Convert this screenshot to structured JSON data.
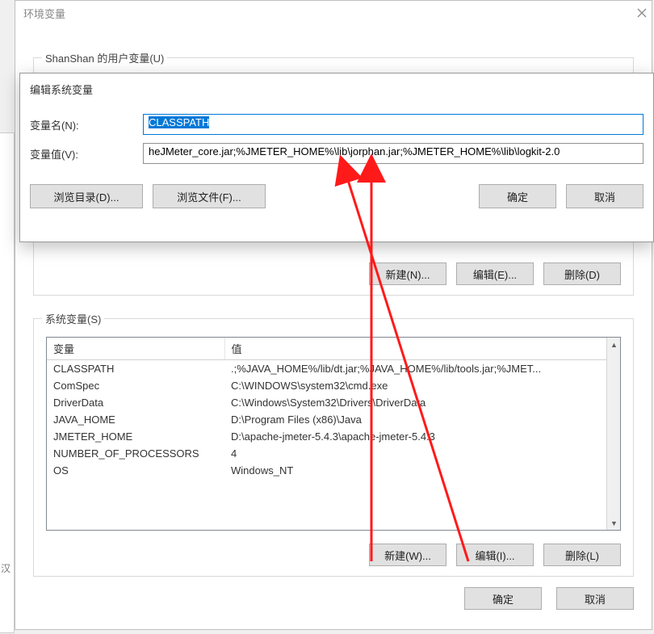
{
  "main_window": {
    "title": "环境变量",
    "user_group_label": "ShanShan 的用户变量(U)",
    "sys_group_label": "系统变量(S)",
    "user_buttons": {
      "new": "新建(N)...",
      "edit": "编辑(E)...",
      "delete": "删除(D)"
    },
    "sys_buttons": {
      "new": "新建(W)...",
      "edit": "编辑(I)...",
      "delete": "删除(L)"
    },
    "lower_buttons": {
      "ok": "确定",
      "cancel": "取消"
    },
    "sys_table": {
      "headers": {
        "var": "变量",
        "val": "值"
      },
      "rows": [
        {
          "var": "CLASSPATH",
          "val": ".;%JAVA_HOME%/lib/dt.jar;%JAVA_HOME%/lib/tools.jar;%JMET..."
        },
        {
          "var": "ComSpec",
          "val": "C:\\WINDOWS\\system32\\cmd.exe"
        },
        {
          "var": "DriverData",
          "val": "C:\\Windows\\System32\\Drivers\\DriverData"
        },
        {
          "var": "JAVA_HOME",
          "val": "D:\\Program Files (x86)\\Java"
        },
        {
          "var": "JMETER_HOME",
          "val": "D:\\apache-jmeter-5.4.3\\apache-jmeter-5.4.3"
        },
        {
          "var": "NUMBER_OF_PROCESSORS",
          "val": "4"
        },
        {
          "var": "OS",
          "val": "Windows_NT"
        }
      ]
    }
  },
  "edit_window": {
    "title": "编辑系统变量",
    "name_label": "变量名(N):",
    "value_label": "变量值(V):",
    "name_value": "CLASSPATH",
    "value_value": "heJMeter_core.jar;%JMETER_HOME%\\lib\\jorphan.jar;%JMETER_HOME%\\lib\\logkit-2.0",
    "buttons": {
      "browse_dir": "浏览目录(D)...",
      "browse_file": "浏览文件(F)...",
      "ok": "确定",
      "cancel": "取消"
    }
  },
  "side_tab": "汉"
}
